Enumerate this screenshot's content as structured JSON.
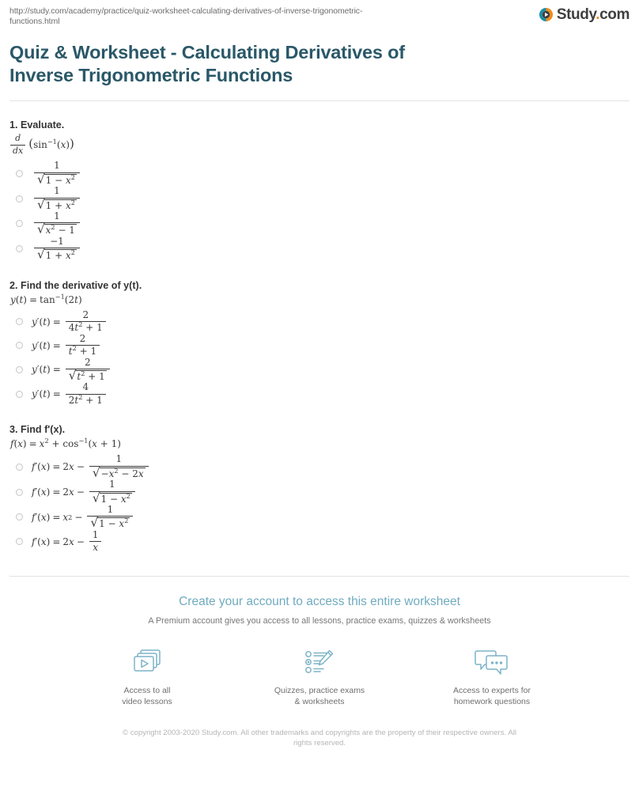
{
  "browser": {
    "url": "http://study.com/academy/practice/quiz-worksheet-calculating-derivatives-of-inverse-trigonometric-functions.html"
  },
  "logo": {
    "name": "Study",
    "dot": ".",
    "com": "com"
  },
  "page_title": "Quiz & Worksheet - Calculating Derivatives of Inverse Trigonometric Functions",
  "questions": [
    {
      "number": "1.",
      "prompt": "1. Evaluate.",
      "expression": "d/dx (sin^-1(x))",
      "options": [
        {
          "text": "1 / sqrt(1 - x^2)"
        },
        {
          "text": "1 / sqrt(1 + x^2)"
        },
        {
          "text": "1 / sqrt(x^2 - 1)"
        },
        {
          "text": "-1 / sqrt(1 + x^2)"
        }
      ]
    },
    {
      "number": "2.",
      "prompt": "2. Find the derivative of y(t).",
      "expression": "y(t) = tan^-1(2t)",
      "options": [
        {
          "text": "y'(t) = 2 / (4t^2 + 1)"
        },
        {
          "text": "y'(t) = 2 / (t^2 + 1)"
        },
        {
          "text": "y'(t) = 2 / sqrt(t^2 + 1)"
        },
        {
          "text": "y'(t) = 4 / (2t^2 + 1)"
        }
      ]
    },
    {
      "number": "3.",
      "prompt": "3. Find f'(x).",
      "expression": "f(x) = x^2 + cos^-1(x + 1)",
      "options": [
        {
          "text": "f'(x) = 2x - 1 / sqrt(-x^2 - 2x)"
        },
        {
          "text": "f'(x) = 2x - 1 / sqrt(1 - x^2)"
        },
        {
          "text": "f'(x) = x^2 - 1 / sqrt(1 - x^2)"
        },
        {
          "text": "f'(x) = 2x - 1 / x"
        }
      ]
    }
  ],
  "cta": {
    "title": "Create your account to access this entire worksheet",
    "subtitle": "A Premium account gives you access to all lessons, practice exams, quizzes & worksheets",
    "features": [
      {
        "icon": "video-cards-icon",
        "line1": "Access to all",
        "line2": "video lessons"
      },
      {
        "icon": "quiz-pencil-icon",
        "line1": "Quizzes, practice exams",
        "line2": "& worksheets"
      },
      {
        "icon": "chat-bubbles-icon",
        "line1": "Access to experts for",
        "line2": "homework questions"
      }
    ]
  },
  "footer": {
    "copyright": "© copyright 2003-2020 Study.com. All other trademarks and copyrights are the property of their respective owners. All rights reserved."
  },
  "colors": {
    "title": "#2a5868",
    "cta_title": "#70abbf",
    "logo_accent": "#f08c1e",
    "icon_stroke": "#7cb4c8"
  }
}
